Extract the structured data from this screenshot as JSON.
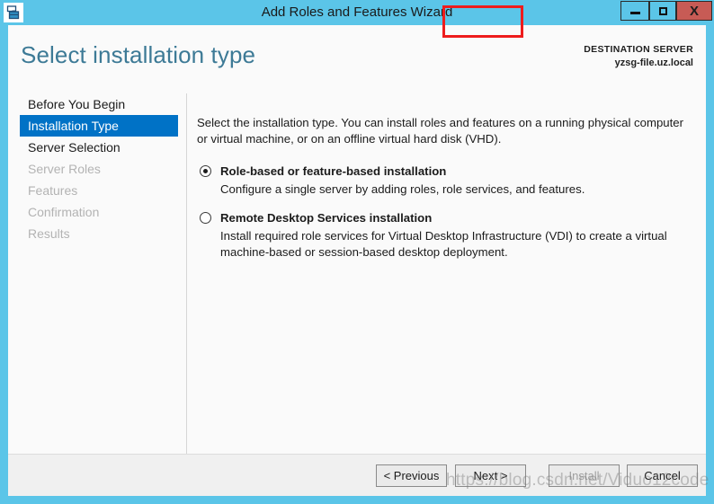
{
  "window": {
    "title": "Add Roles and Features Wizard",
    "icon": "server-manager-icon",
    "frame_color": "#5bc5e8",
    "controls": {
      "minimize": "minimize-icon",
      "maximize": "maximize-icon",
      "close": "X",
      "close_color": "#c75b55"
    }
  },
  "header": {
    "page_title": "Select installation type",
    "destination_label": "DESTINATION SERVER",
    "destination_server": "yzsg-file.uz.local",
    "title_color": "#3d7a96"
  },
  "sidebar": {
    "selected_color": "#0072c6",
    "items": [
      {
        "label": "Before You Begin",
        "state": "enabled"
      },
      {
        "label": "Installation Type",
        "state": "selected"
      },
      {
        "label": "Server Selection",
        "state": "enabled"
      },
      {
        "label": "Server Roles",
        "state": "disabled"
      },
      {
        "label": "Features",
        "state": "disabled"
      },
      {
        "label": "Confirmation",
        "state": "disabled"
      },
      {
        "label": "Results",
        "state": "disabled"
      }
    ]
  },
  "content": {
    "intro": "Select the installation type. You can install roles and features on a running physical computer or virtual machine, or on an offline virtual hard disk (VHD).",
    "options": [
      {
        "label": "Role-based or feature-based installation",
        "description": "Configure a single server by adding roles, role services, and features.",
        "selected": true
      },
      {
        "label": "Remote Desktop Services installation",
        "description": "Install required role services for Virtual Desktop Infrastructure (VDI) to create a virtual machine-based or session-based desktop deployment.",
        "selected": false
      }
    ]
  },
  "footer": {
    "previous_label": "< Previous",
    "next_label": "Next >",
    "install_label": "Install",
    "cancel_label": "Cancel",
    "install_disabled": true,
    "highlight_color": "#ee1c1c"
  },
  "watermark": {
    "text": "https://blog.csdn.net/Viduo12code"
  }
}
